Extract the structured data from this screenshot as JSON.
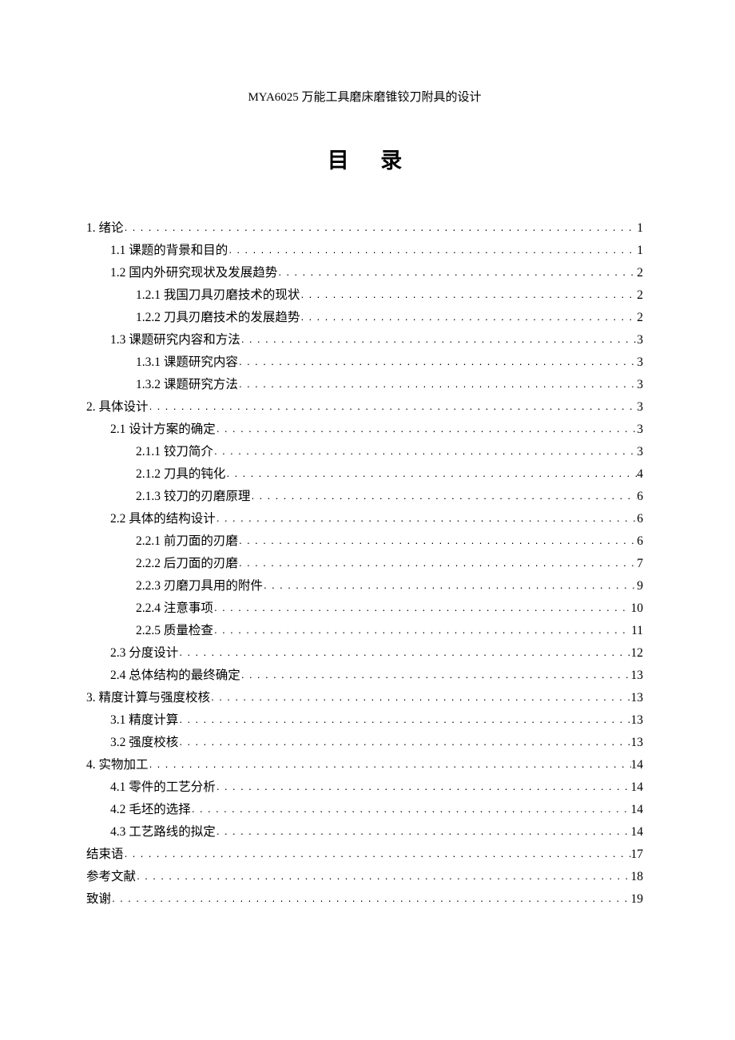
{
  "doc_title": "MYA6025 万能工具磨床磨锥铰刀附具的设计",
  "toc_title": "目 录",
  "toc": [
    {
      "indent": 0,
      "label": "1. 绪论",
      "page": "1"
    },
    {
      "indent": 1,
      "label": "1.1 课题的背景和目的",
      "page": "1"
    },
    {
      "indent": 1,
      "label": "1.2  国内外研究现状及发展趋势",
      "page": "2"
    },
    {
      "indent": 2,
      "label": "1.2.1  我国刀具刃磨技术的现状",
      "page": "2"
    },
    {
      "indent": 2,
      "label": "1.2.2 刀具刃磨技术的发展趋势",
      "page": "2"
    },
    {
      "indent": 1,
      "label": "1.3 课题研究内容和方法",
      "page": "3"
    },
    {
      "indent": 2,
      "label": "1.3.1 课题研究内容",
      "page": "3"
    },
    {
      "indent": 2,
      "label": "1.3.2 课题研究方法",
      "page": "3"
    },
    {
      "indent": 0,
      "label": "2. 具体设计",
      "page": "3"
    },
    {
      "indent": 1,
      "label": "2.1 设计方案的确定",
      "page": "3"
    },
    {
      "indent": 2,
      "label": "2.1.1 铰刀简介",
      "page": "3"
    },
    {
      "indent": 2,
      "label": "2.1.2 刀具的钝化",
      "page": "4"
    },
    {
      "indent": 2,
      "label": "2.1.3 铰刀的刃磨原理",
      "page": "6"
    },
    {
      "indent": 1,
      "label": "2.2 具体的结构设计",
      "page": "6"
    },
    {
      "indent": 2,
      "label": "2.2.1 前刀面的刃磨",
      "page": "6"
    },
    {
      "indent": 2,
      "label": "2.2.2 后刀面的刃磨",
      "page": "7"
    },
    {
      "indent": 2,
      "label": "2.2.3 刃磨刀具用的附件",
      "page": "9"
    },
    {
      "indent": 2,
      "label": "2.2.4 注意事项",
      "page": "10"
    },
    {
      "indent": 2,
      "label": "2.2.5 质量检查",
      "page": "11"
    },
    {
      "indent": 1,
      "label": "2.3 分度设计",
      "page": "12"
    },
    {
      "indent": 1,
      "label": "2.4 总体结构的最终确定",
      "page": "13"
    },
    {
      "indent": 0,
      "label": "3. 精度计算与强度校核",
      "page": "13"
    },
    {
      "indent": 1,
      "label": "3.1 精度计算",
      "page": "13"
    },
    {
      "indent": 1,
      "label": "3.2 强度校核",
      "page": "13"
    },
    {
      "indent": 0,
      "label": "4. 实物加工",
      "page": "14"
    },
    {
      "indent": 1,
      "label": "4.1  零件的工艺分析",
      "page": "14"
    },
    {
      "indent": 1,
      "label": "4.2 毛坯的选择",
      "page": "14"
    },
    {
      "indent": 1,
      "label": "4.3 工艺路线的拟定",
      "page": "14"
    },
    {
      "indent": 0,
      "label": "结束语",
      "page": "17"
    },
    {
      "indent": 0,
      "label": "参考文献",
      "page": "18"
    },
    {
      "indent": 0,
      "label": "致谢",
      "page": "19"
    }
  ]
}
